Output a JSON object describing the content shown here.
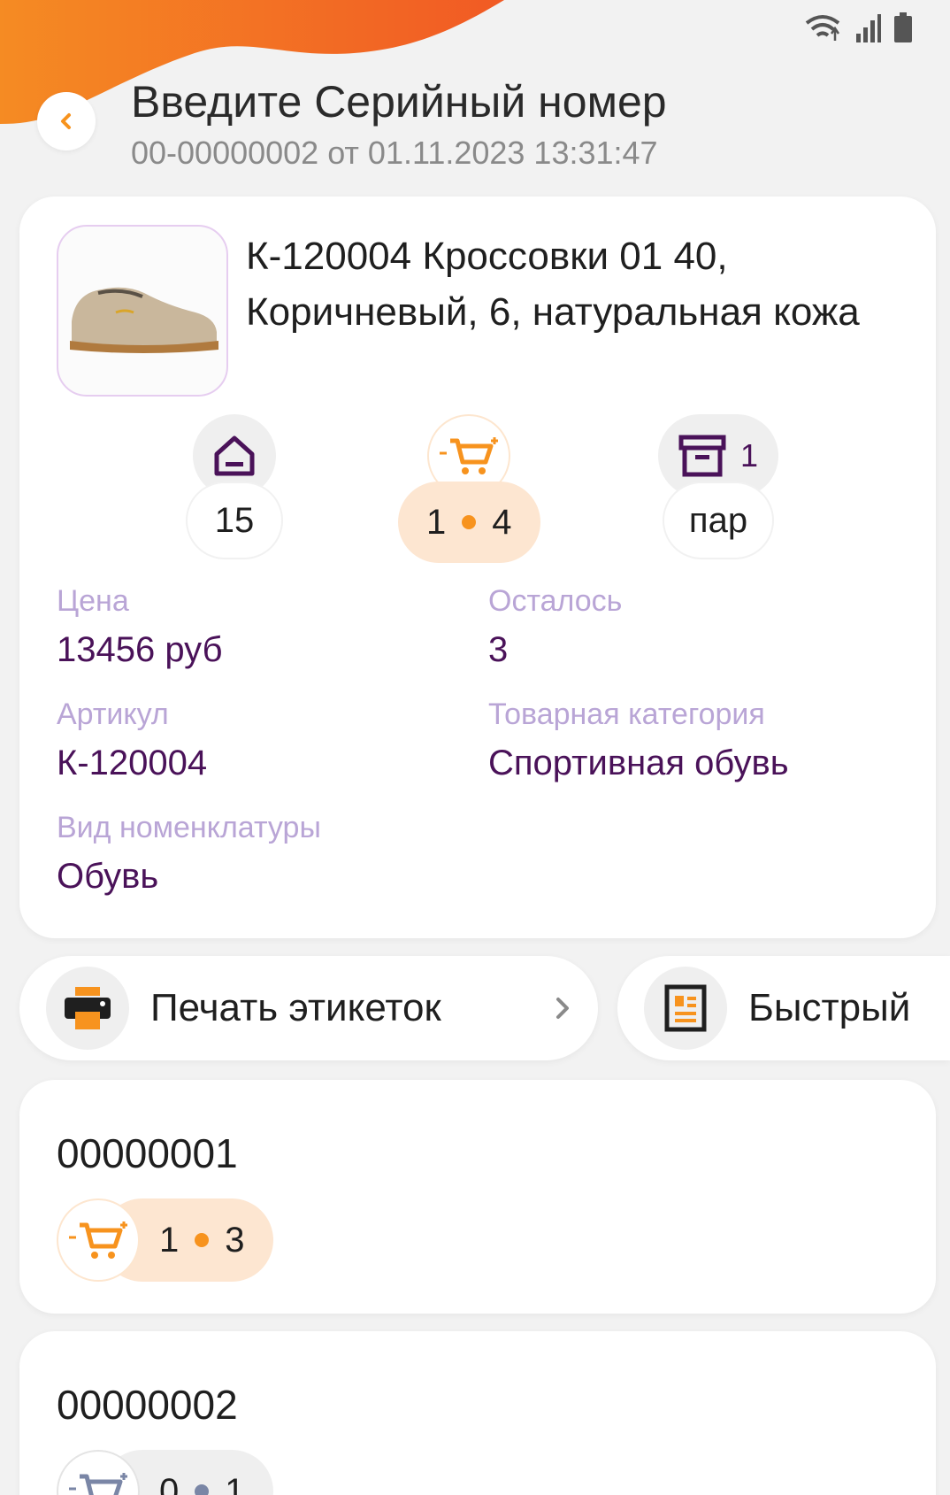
{
  "header": {
    "title": "Введите Серийный номер",
    "subtitle": "00-00000002 от 01.11.2023 13:31:47"
  },
  "product": {
    "name": "К-120004 Кроссовки  01  40, Коричневый, 6, натуральная кожа",
    "stats": {
      "warehouse_qty": "15",
      "cart_left": "1",
      "cart_right": "4",
      "box_count": "1",
      "unit": "пар"
    },
    "fields": {
      "price_label": "Цена",
      "price_value": "13456 руб",
      "remaining_label": "Осталось",
      "remaining_value": "3",
      "article_label": "Артикул",
      "article_value": "К-120004",
      "category_label": "Товарная категория",
      "category_value": "Спортивная обувь",
      "kind_label": "Вид номенклатуры",
      "kind_value": "Обувь"
    }
  },
  "actions": {
    "print_labels": "Печать этикеток",
    "quick": "Быстрый"
  },
  "serials": [
    {
      "number": "00000001",
      "left": "1",
      "right": "3"
    },
    {
      "number": "00000002",
      "left": "0",
      "right": "1"
    }
  ],
  "colors": {
    "accent_orange": "#f7931e",
    "brand_purple": "#4a1259",
    "label_lilac": "#b9a5d6"
  }
}
